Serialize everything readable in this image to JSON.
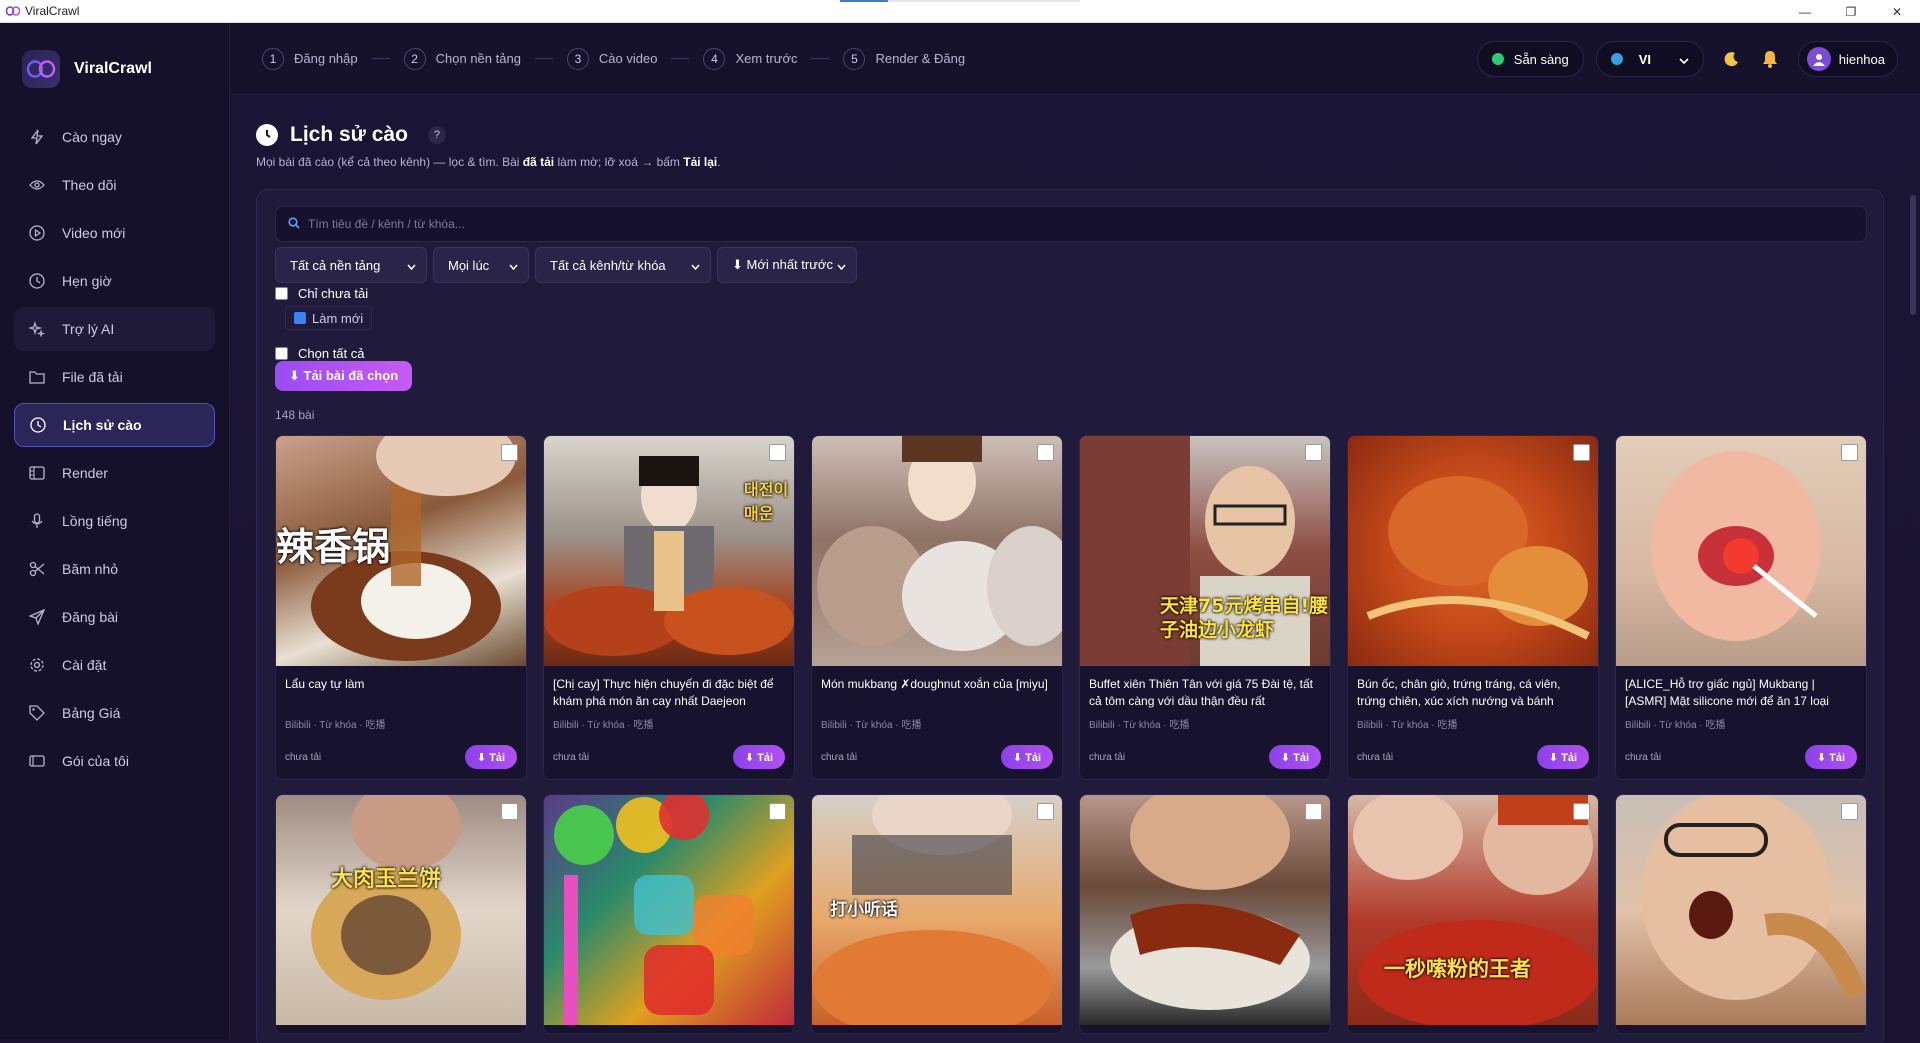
{
  "window": {
    "title": "ViralCrawl",
    "minimize": "—",
    "restore": "❐",
    "close": "✕"
  },
  "sidebar": {
    "brand": "ViralCrawl",
    "items": [
      {
        "label": "Cào ngay",
        "icon": "bolt-icon"
      },
      {
        "label": "Theo dõi",
        "icon": "eye-icon"
      },
      {
        "label": "Video mới",
        "icon": "play-icon"
      },
      {
        "label": "Hẹn giờ",
        "icon": "clock-icon"
      },
      {
        "label": "Trợ lý AI",
        "icon": "sparkle-icon"
      },
      {
        "label": "File đã tải",
        "icon": "folder-icon"
      },
      {
        "label": "Lịch sử cào",
        "icon": "history-icon"
      },
      {
        "label": "Render",
        "icon": "film-icon"
      },
      {
        "label": "Lồng tiếng",
        "icon": "mic-icon"
      },
      {
        "label": "Băm nhỏ",
        "icon": "scissors-icon"
      },
      {
        "label": "Đăng bài",
        "icon": "send-icon"
      },
      {
        "label": "Cài đặt",
        "icon": "gear-icon"
      },
      {
        "label": "Bảng Giá",
        "icon": "tag-icon"
      },
      {
        "label": "Gói của tôi",
        "icon": "card-icon"
      }
    ]
  },
  "steps": [
    {
      "num": "1",
      "label": "Đăng nhập"
    },
    {
      "num": "2",
      "label": "Chọn nền tảng"
    },
    {
      "num": "3",
      "label": "Cào video"
    },
    {
      "num": "4",
      "label": "Xem trước"
    },
    {
      "num": "5",
      "label": "Render & Đăng"
    }
  ],
  "topbar": {
    "status": "Sẵn sàng",
    "lang": "VI",
    "user": "hienhoa"
  },
  "page": {
    "title": "Lịch sử cào",
    "help": "?",
    "subtitle_a": "Mọi bài đã cào (kể cả theo kênh) — lọc & tìm. Bài ",
    "subtitle_b": "đã tải",
    "subtitle_c": " làm mờ; lỡ xoá → bấm ",
    "subtitle_d": "Tải lại",
    "subtitle_e": "."
  },
  "search": {
    "placeholder": "Tìm tiêu đề / kênh / từ khóa..."
  },
  "filters": {
    "platform": "Tất cả nền tảng",
    "time": "Mọi lúc",
    "channel": "Tất cả kênh/từ khóa",
    "sort": "⬇ Mới nhất trước"
  },
  "only_not_downloaded": "Chỉ chưa tải",
  "refresh": "Làm mới",
  "select_all": "Chọn tất cả",
  "download_selected": "⬇ Tải bài đã chọn",
  "count": "148 bài",
  "cards": [
    {
      "title": "Lẩu cay tự làm",
      "meta": "Bilibili · Từ khóa · 吃播",
      "status": "chưa tải",
      "btn": "⬇ Tải",
      "caption": "辣香锅"
    },
    {
      "title": "[Chị cay] Thực hiện chuyến đi đặc biệt để khám phá món ăn cay nhất Daejeon",
      "meta": "Bilibili · Từ khóa · 吃播",
      "status": "chưa tải",
      "btn": "⬇ Tải",
      "caption": "대전이 매운"
    },
    {
      "title": "Món mukbang ✗doughnut xoắn của [miyu]",
      "meta": "Bilibili · Từ khóa · 吃播",
      "status": "chưa tải",
      "btn": "⬇ Tải",
      "caption": ""
    },
    {
      "title": "Buffet xiên Thiên Tân với giá 75 Đài tệ, tất cả tôm càng với dầu thận đều rất",
      "meta": "Bilibili · Từ khóa · 吃播",
      "status": "chưa tải",
      "btn": "⬇ Tải",
      "caption": "天津75元烤串自!腰子油边小龙虾"
    },
    {
      "title": "Bún ốc, chân giò, trứng tráng, cá viên, trứng chiên, xúc xích nướng và bánh",
      "meta": "Bilibili · Từ khóa · 吃播",
      "status": "chưa tải",
      "btn": "⬇ Tải",
      "caption": ""
    },
    {
      "title": "[ALICE_Hỗ trợ giấc ngủ] Mukbang | [ASMR] Mặt silicone mới để ăn 17 loại",
      "meta": "Bilibili · Từ khóa · 吃播",
      "status": "chưa tải",
      "btn": "⬇ Tải",
      "caption": ""
    },
    {
      "caption": "大肉玉兰饼"
    },
    {
      "caption": ""
    },
    {
      "caption": "打小听话"
    },
    {
      "caption": ""
    },
    {
      "caption": "一秒嗦粉的王者"
    },
    {
      "caption": ""
    }
  ],
  "colors": {
    "accent": "#9a4cf0",
    "active_border": "#5a4fc0",
    "status_green": "#2ecc71"
  }
}
